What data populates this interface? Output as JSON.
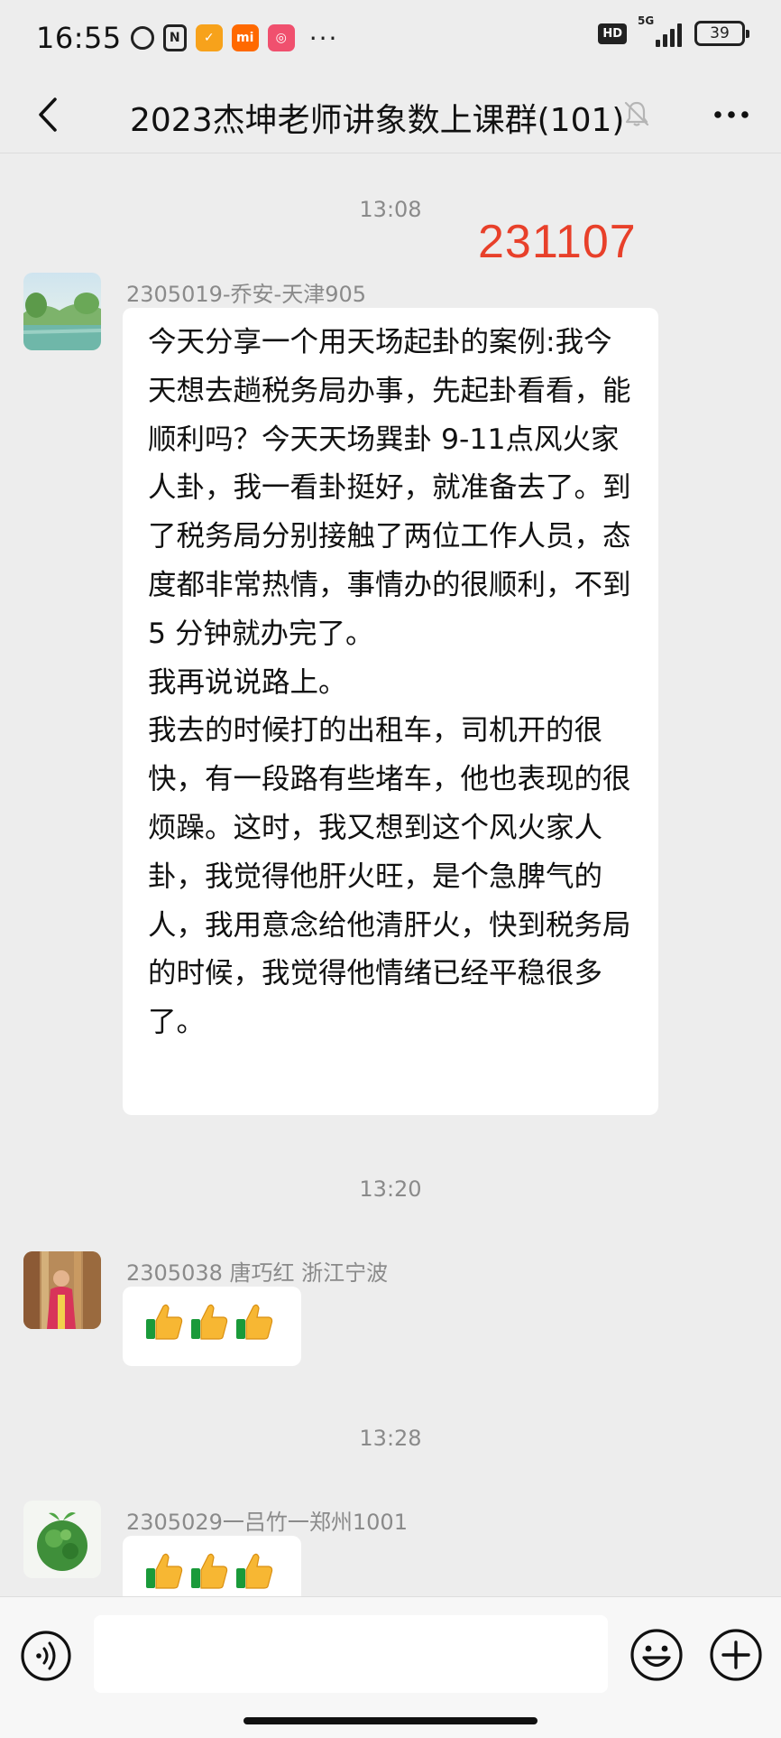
{
  "status_bar": {
    "time": "16:55",
    "more": "···",
    "hd": "HD",
    "network": "5G",
    "battery": "39"
  },
  "header": {
    "title": "2023杰坤老师讲象数上课群(101)"
  },
  "overlay_number": "231107",
  "messages": [
    {
      "time": "13:08",
      "sender": "2305019-乔安-天津905",
      "text": "今天分享一个用天场起卦的案例:我今天想去趟税务局办事，先起卦看看，能顺利吗？今天天场巽卦 9-11点风火家人卦，我一看卦挺好，就准备去了。到了税务局分别接触了两位工作人员，态度都非常热情，事情办的很顺利，不到 5 分钟就办完了。\n我再说说路上。\n我去的时候打的出租车，司机开的很快，有一段路有些堵车，他也表现的很烦躁。这时，我又想到这个风火家人卦，我觉得他肝火旺，是个急脾气的人，我用意念给他清肝火，快到税务局的时候，我觉得他情绪已经平稳很多了。"
    },
    {
      "time": "13:20",
      "sender": "2305038  唐巧红   浙江宁波",
      "emoji": "thumbs-up ×3"
    },
    {
      "time": "13:28",
      "sender": "2305029一吕竹一郑州1001",
      "emoji": "thumbs-up ×3"
    }
  ],
  "colors": {
    "background": "#ededed",
    "bubble": "#ffffff",
    "overlay_number": "#e8402a",
    "meta_text": "#8a8a8a"
  },
  "icons": [
    "back-arrow-icon",
    "mute-bell-icon",
    "more-dots-icon",
    "voice-icon",
    "emoji-icon",
    "plus-icon"
  ]
}
